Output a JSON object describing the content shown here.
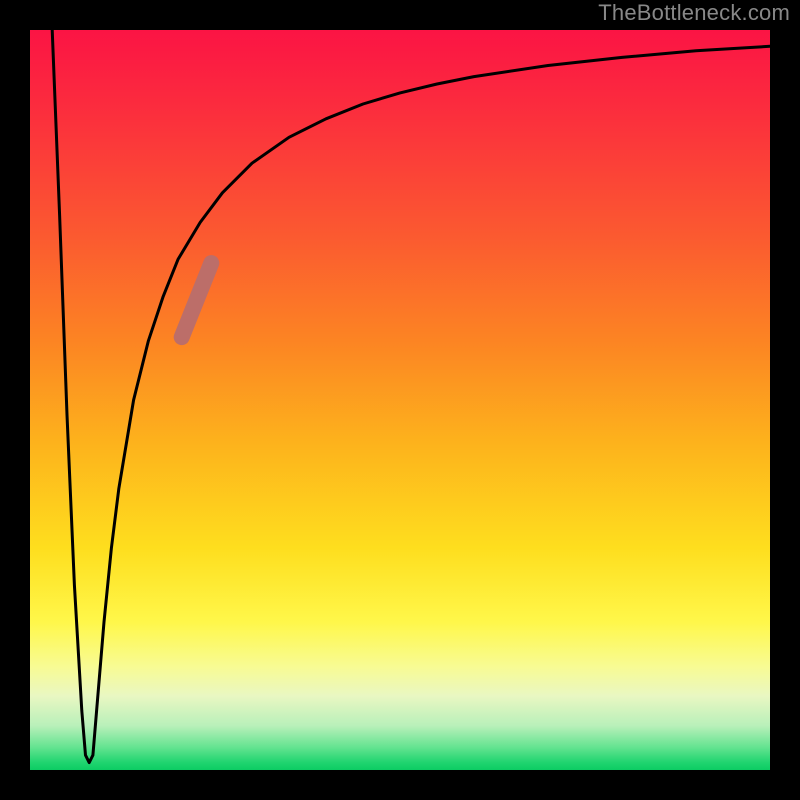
{
  "watermark": "TheBottleneck.com",
  "colors": {
    "frame": "#000000",
    "curve": "#000000",
    "marker": "#BC6E69",
    "gradient_top": "#fb1444",
    "gradient_bottom": "#0ccc63"
  },
  "chart_data": {
    "type": "line",
    "title": "",
    "xlabel": "",
    "ylabel": "",
    "xlim": [
      0,
      100
    ],
    "ylim": [
      0,
      100
    ],
    "grid": false,
    "series": [
      {
        "name": "bottleneck-curve",
        "x": [
          3,
          4,
          5,
          6,
          7,
          7.5,
          8,
          8.5,
          9,
          10,
          11,
          12,
          14,
          16,
          18,
          20,
          23,
          26,
          30,
          35,
          40,
          45,
          50,
          55,
          60,
          70,
          80,
          90,
          100
        ],
        "y": [
          100,
          75,
          48,
          25,
          8,
          2,
          1,
          2,
          8,
          20,
          30,
          38,
          50,
          58,
          64,
          69,
          74,
          78,
          82,
          85.5,
          88,
          90,
          91.5,
          92.7,
          93.7,
          95.2,
          96.3,
          97.2,
          97.8
        ]
      }
    ],
    "marker": {
      "name": "highlight-region",
      "p0": {
        "x": 20.5,
        "y": 58.5
      },
      "p1": {
        "x": 24.5,
        "y": 68.5
      }
    },
    "legend": null
  }
}
